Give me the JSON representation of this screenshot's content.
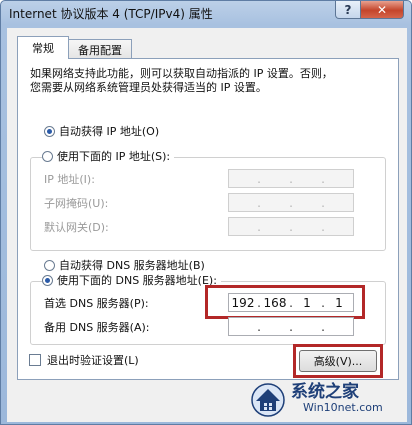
{
  "window": {
    "title": "Internet 协议版本 4 (TCP/IPv4) 属性",
    "help_glyph": "?",
    "close_glyph": "✕"
  },
  "tabs": [
    {
      "label": "常规",
      "active": true
    },
    {
      "label": "备用配置",
      "active": false
    }
  ],
  "description": {
    "line1": "如果网络支持此功能，则可以获取自动指派的 IP 设置。否则，",
    "line2": "您需要从网络系统管理员处获得适当的 IP 设置。"
  },
  "ip_section": {
    "auto_label": "自动获得 IP 地址(O)",
    "auto_selected": true,
    "manual_label": "使用下面的 IP 地址(S):",
    "manual_selected": false,
    "fields": [
      {
        "label": "IP 地址(I):",
        "octets": [
          "",
          "",
          "",
          ""
        ]
      },
      {
        "label": "子网掩码(U):",
        "octets": [
          "",
          "",
          "",
          ""
        ]
      },
      {
        "label": "默认网关(D):",
        "octets": [
          "",
          "",
          "",
          ""
        ]
      }
    ]
  },
  "dns_section": {
    "auto_label": "自动获得 DNS 服务器地址(B)",
    "auto_selected": false,
    "manual_label": "使用下面的 DNS 服务器地址(E):",
    "manual_selected": true,
    "fields": [
      {
        "label": "首选 DNS 服务器(P):",
        "octets": [
          "192",
          "168",
          "1",
          "1"
        ]
      },
      {
        "label": "备用 DNS 服务器(A):",
        "octets": [
          "",
          "",
          "",
          ""
        ]
      }
    ]
  },
  "validate_checkbox": {
    "label": "退出时验证设置(L)",
    "checked": false
  },
  "advanced_button": {
    "label": "高级(V)..."
  },
  "watermark": {
    "name": "系统之家",
    "url": "Win10net.com"
  },
  "colors": {
    "highlight": "#b32828",
    "accent": "#2a5aa8"
  }
}
